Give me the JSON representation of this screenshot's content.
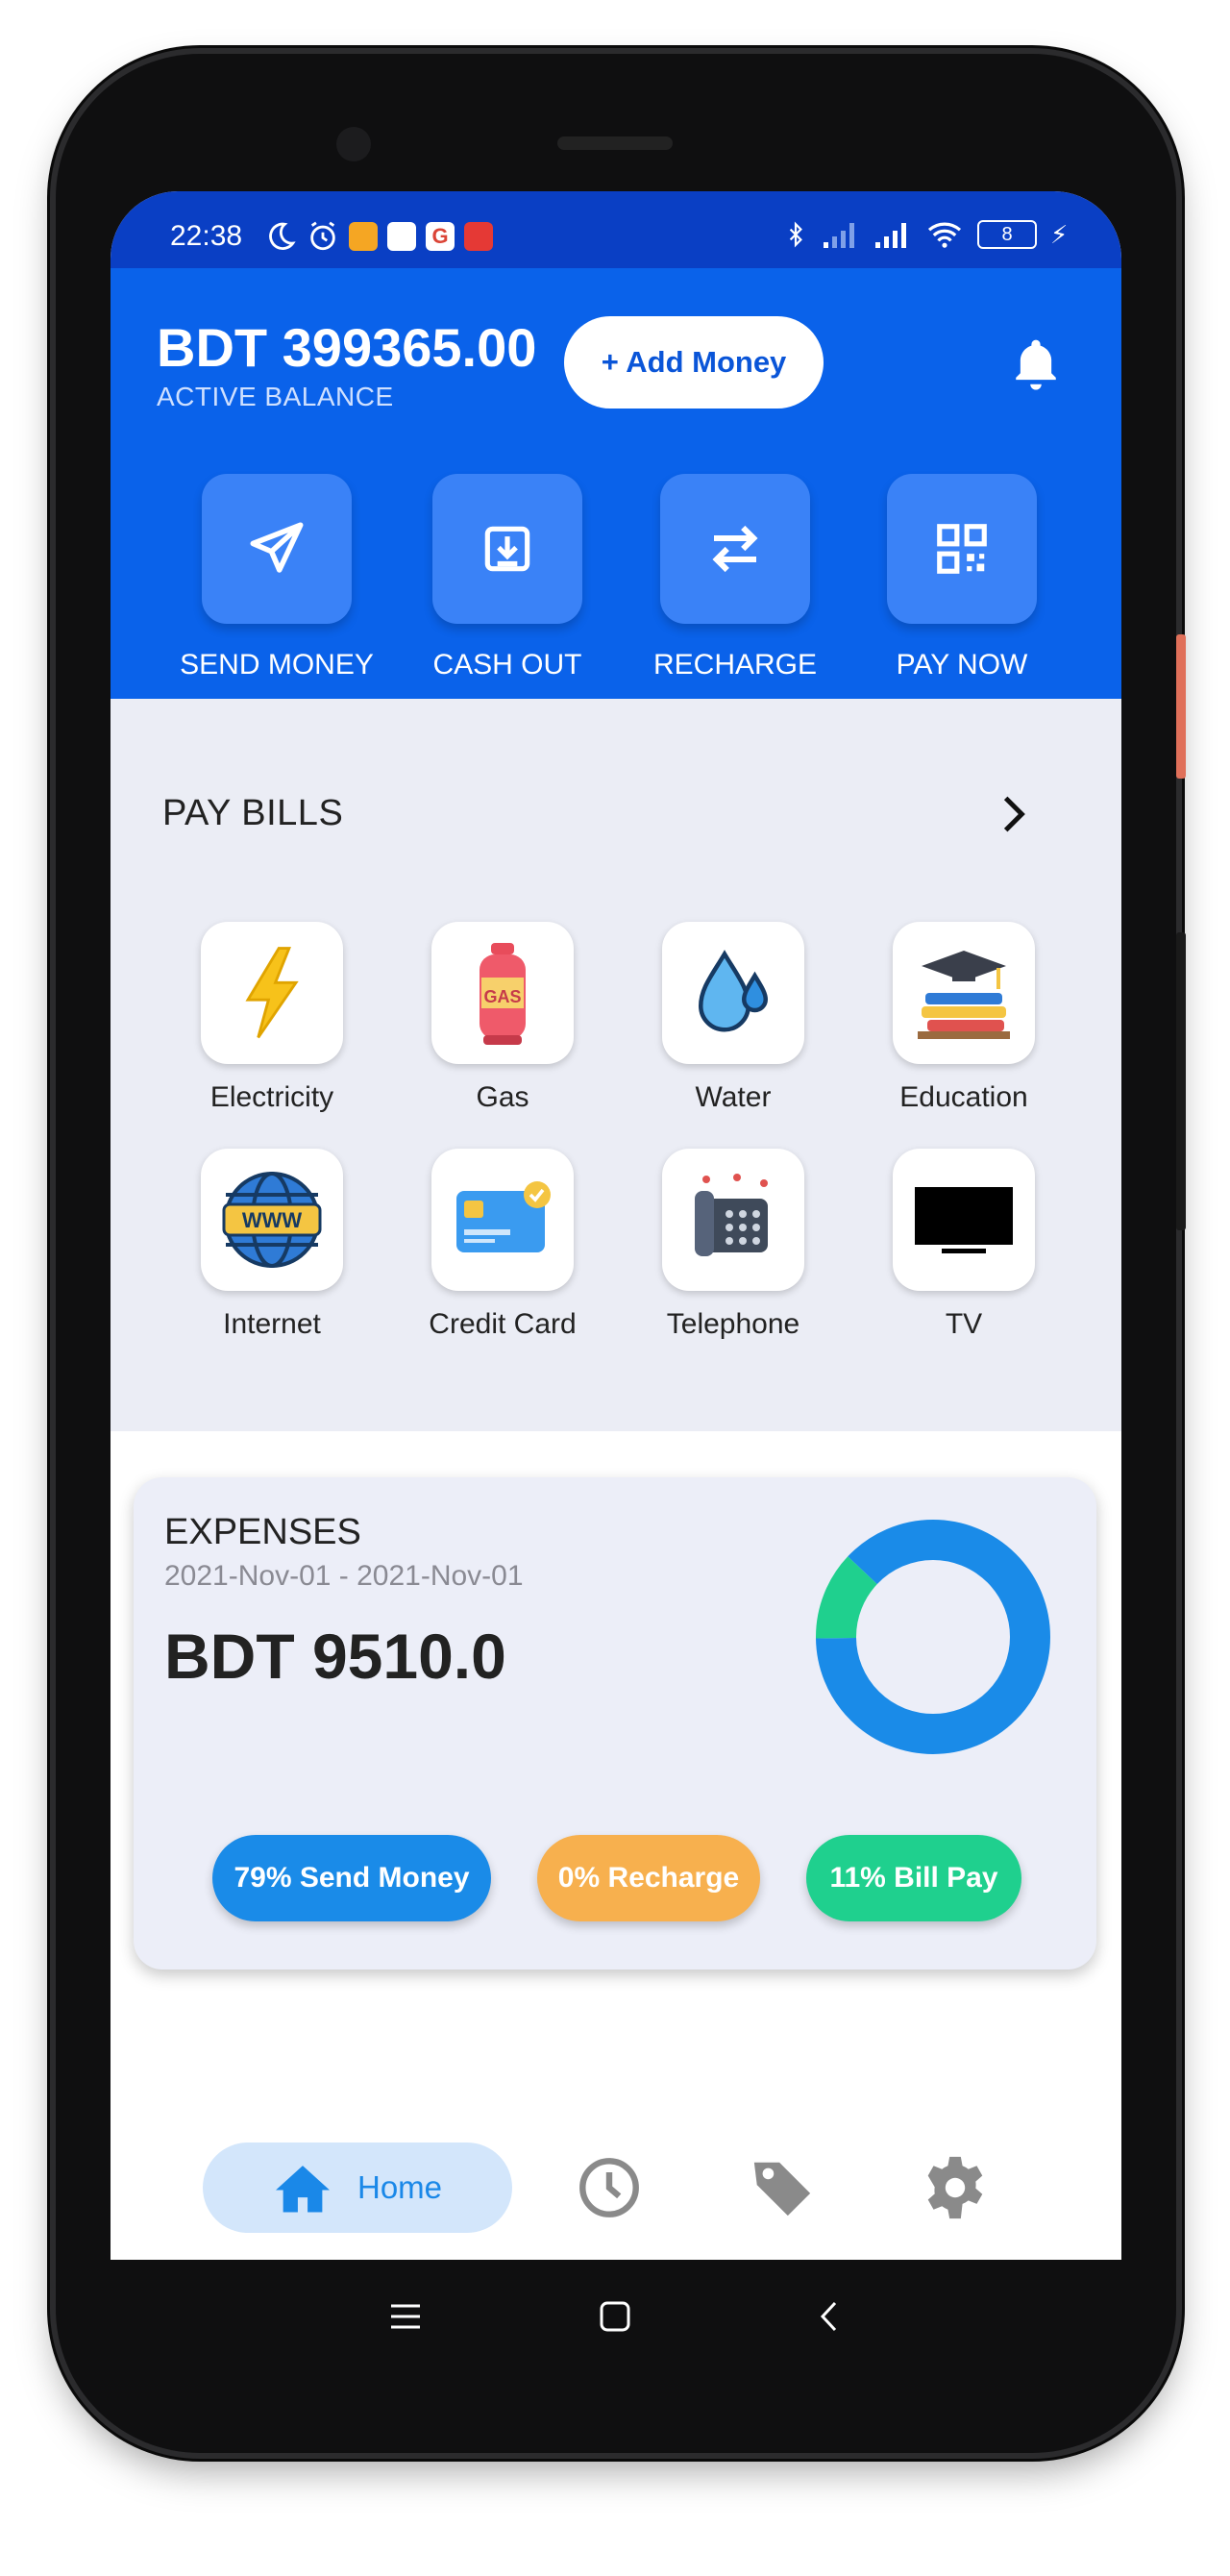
{
  "status_bar": {
    "time": "22:38",
    "battery": "8"
  },
  "header": {
    "balance_amount": "BDT 399365.00",
    "balance_label": "ACTIVE BALANCE",
    "add_money_label": "+ Add Money"
  },
  "quick_actions": [
    {
      "label": "SEND MONEY",
      "icon": "send-icon"
    },
    {
      "label": "CASH OUT",
      "icon": "cash-out-icon"
    },
    {
      "label": "RECHARGE",
      "icon": "swap-arrows-icon"
    },
    {
      "label": "PAY NOW",
      "icon": "qr-code-icon"
    }
  ],
  "pay_bills": {
    "title": "PAY BILLS",
    "items": [
      {
        "label": "Electricity",
        "icon": "lightning-bolt-icon"
      },
      {
        "label": "Gas",
        "icon": "gas-cylinder-icon",
        "icon_text": "GAS"
      },
      {
        "label": "Water",
        "icon": "water-drop-icon"
      },
      {
        "label": "Education",
        "icon": "graduation-books-icon"
      },
      {
        "label": "Internet",
        "icon": "globe-www-icon",
        "icon_text": "WWW"
      },
      {
        "label": "Credit Card",
        "icon": "credit-card-icon"
      },
      {
        "label": "Telephone",
        "icon": "telephone-icon"
      },
      {
        "label": "TV",
        "icon": "tv-icon"
      }
    ]
  },
  "expenses": {
    "title": "EXPENSES",
    "date_range": "2021-Nov-01 - 2021-Nov-01",
    "amount": "BDT 9510.0",
    "pills": [
      {
        "label": "79% Send Money",
        "color": "#1a8be8"
      },
      {
        "label": "0% Recharge",
        "color": "#f7b04e"
      },
      {
        "label": "11% Bill Pay",
        "color": "#1fd08e"
      }
    ]
  },
  "chart_data": {
    "type": "pie",
    "categories": [
      "Send Money",
      "Recharge",
      "Bill Pay"
    ],
    "values": [
      79,
      0,
      11
    ],
    "colors": [
      "#1a8be8",
      "#f7b04e",
      "#1fd08e"
    ]
  },
  "bottom_nav": {
    "home_label": "Home",
    "items": [
      "home-icon",
      "history-clock-icon",
      "tag-icon",
      "gear-icon"
    ]
  },
  "colors": {
    "header_blue": "#0a62ea",
    "status_blue": "#0a3fc4",
    "action_tile": "#3a82f7",
    "bills_bg": "#ebedf5"
  }
}
